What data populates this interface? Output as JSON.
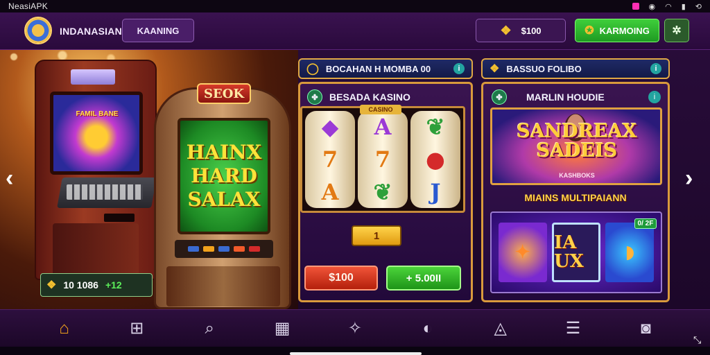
{
  "status_bar": {
    "app_name": "NeasiAPK"
  },
  "header": {
    "brand": "INDANASIAN",
    "tab_button": "KAANING",
    "coins_value": "$100",
    "green_button": "KARMOING"
  },
  "hero": {
    "arcade_screen_text": "FAMIL BANE",
    "slot_sign": "SEOK",
    "slot_screen_lines": [
      "HAINX",
      "HARD",
      "SALAX"
    ],
    "balance_value": "10 1086",
    "balance_gain": "+12"
  },
  "center": {
    "pill_label": "BOCAHAN H MOMBA 00",
    "card_title": "BESADA KASINO",
    "reel_tag": "CASINO",
    "reels": [
      [
        "◆",
        "7",
        "A"
      ],
      [
        "A",
        "7",
        "❦"
      ],
      [
        "❦",
        "●",
        "J"
      ]
    ],
    "bet_value": "1",
    "red_button": "$100",
    "green_button": "+ 5.00II"
  },
  "right": {
    "pill_label": "BASSUO FOLIBO",
    "card_title": "MARLIN HOUDIE",
    "banner_title": "SANDREAX SADEIS",
    "banner_subtitle": "KASHBOKS",
    "section_label": "MIAINS MULTIPAIANN",
    "tile_b_text": "IA UX",
    "tile_c_tag": "0/ 2F"
  },
  "icons": {
    "nav": [
      "home-icon",
      "grid-icon",
      "search-icon",
      "calculator-icon",
      "magic-wand-icon",
      "chat-icon",
      "bag-icon",
      "list-icon",
      "camera-icon"
    ]
  },
  "colors": {
    "accent": "#f2a21c",
    "brand_purple": "#2a0d3c",
    "gold_border": "#d99a3c",
    "green": "#2fb32a"
  }
}
